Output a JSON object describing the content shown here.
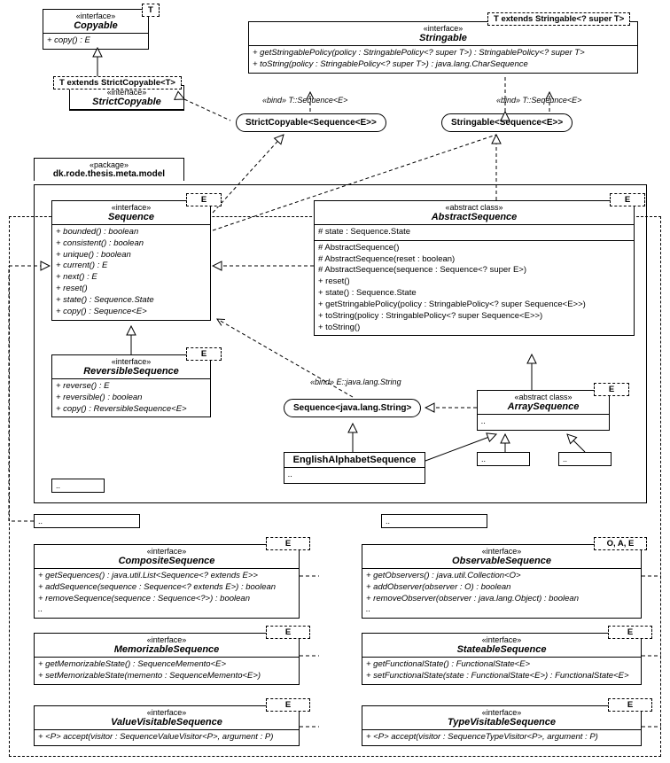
{
  "copyable": {
    "stereo": "«interface»",
    "name": "Copyable",
    "param": "T",
    "ops": [
      "+ copy() : E"
    ]
  },
  "strictCopyable": {
    "stereo": "«interface»",
    "name": "StrictCopyable",
    "param": "T extends StrictCopyable<T>"
  },
  "stringable": {
    "stereo": "«interface»",
    "name": "Stringable",
    "param": "T extends Stringable<? super T>",
    "ops": [
      "+ getStringablePolicy(policy : StringablePolicy<? super T>) : StringablePolicy<? super T>",
      "+ toString(policy : StringablePolicy<? super T>) : java.lang.CharSequence"
    ]
  },
  "bindStrictCopyable": "StrictCopyable<Sequence<E>>",
  "bindStringable": "Stringable<Sequence<E>>",
  "bindLabel1": "«bind» T::Sequence<E>",
  "bindLabel2": "«bind» T::Seqeunce<E>",
  "package": {
    "stereo": "«package»",
    "name": "dk.rode.thesis.meta.model"
  },
  "sequence": {
    "stereo": "«interface»",
    "name": "Sequence",
    "param": "E",
    "ops": [
      "+ bounded() : boolean",
      "+ consistent() : boolean",
      "+ unique() : boolean",
      "+ current() : E",
      "+ next() : E",
      "+ reset()",
      "+ state() : Sequence.State",
      "+ copy() : Sequence<E>"
    ]
  },
  "abstractSequence": {
    "stereo": "«abstract class»",
    "name": "AbstractSequence",
    "param": "E",
    "attrs": [
      "# state : Sequence.State"
    ],
    "ops": [
      "# AbstractSequence()",
      "# AbstractSequence(reset : boolean)",
      "# AbstractSequence(sequence : Sequence<? super E>)",
      "+ reset()",
      "+ state() : Sequence.State",
      "+ getStringablePolicy(policy : StringablePolicy<? super Sequence<E>>)",
      "+ toString(policy : StringablePolicy<? super Sequence<E>>)",
      "+ toString()"
    ]
  },
  "reversibleSequence": {
    "stereo": "«interface»",
    "name": "ReversibleSequence",
    "param": "E",
    "ops": [
      "+ reverse() : E",
      "+ reversible() : boolean",
      "+ copy() : ReversibleSequence<E>"
    ]
  },
  "bindSequenceString": "Sequence<java.lang.String>",
  "bindLabel3": "«bind» E::java.lang.String",
  "arraySequence": {
    "stereo": "«abstract class»",
    "name": "ArraySequence",
    "param": "E"
  },
  "englishAlphabet": {
    "name": "EnglishAlphabetSequence"
  },
  "compositeSequence": {
    "stereo": "«interface»",
    "name": "CompositeSequence",
    "param": "E",
    "ops": [
      "+ getSequences() : java.util.List<Sequence<? extends E>>",
      "+ addSequence(sequence : Sequence<? extends E>) : boolean",
      "+ removeSequence(sequence : Sequence<?>) : boolean",
      ".."
    ]
  },
  "observableSequence": {
    "stereo": "«interface»",
    "name": "ObservableSequence",
    "param": "O, A, E",
    "ops": [
      "+ getObservers() : java.util.Collection<O>",
      "+ addObserver(observer : O) : boolean",
      "+ removeObserver(observer : java.lang.Object) : boolean",
      ".."
    ]
  },
  "memorizableSequence": {
    "stereo": "«interface»",
    "name": "MemorizableSequence",
    "param": "E",
    "ops": [
      "+ getMemorizableState() : SequenceMemento<E>",
      "+ setMemorizableState(memento : SequenceMemento<E>)"
    ]
  },
  "stateableSequence": {
    "stereo": "«interface»",
    "name": "StateableSequence",
    "param": "E",
    "ops": [
      "+ getFunctionalState() : FunctionalState<E>",
      "+ setFunctionalState(state : FunctionalState<E>) : FunctionalState<E>"
    ]
  },
  "valueVisitableSequence": {
    "stereo": "«interface»",
    "name": "ValueVisitableSequence",
    "param": "E",
    "ops": [
      "+ <P> accept(visitor : SequenceValueVisitor<P>, argument : P)"
    ]
  },
  "typeVisitableSequence": {
    "stereo": "«interface»",
    "name": "TypeVisitableSequence",
    "param": "E",
    "ops": [
      "+ <P> accept(visitor : SequenceTypeVisitor<P>, argument : P)"
    ]
  },
  "dots": ".."
}
